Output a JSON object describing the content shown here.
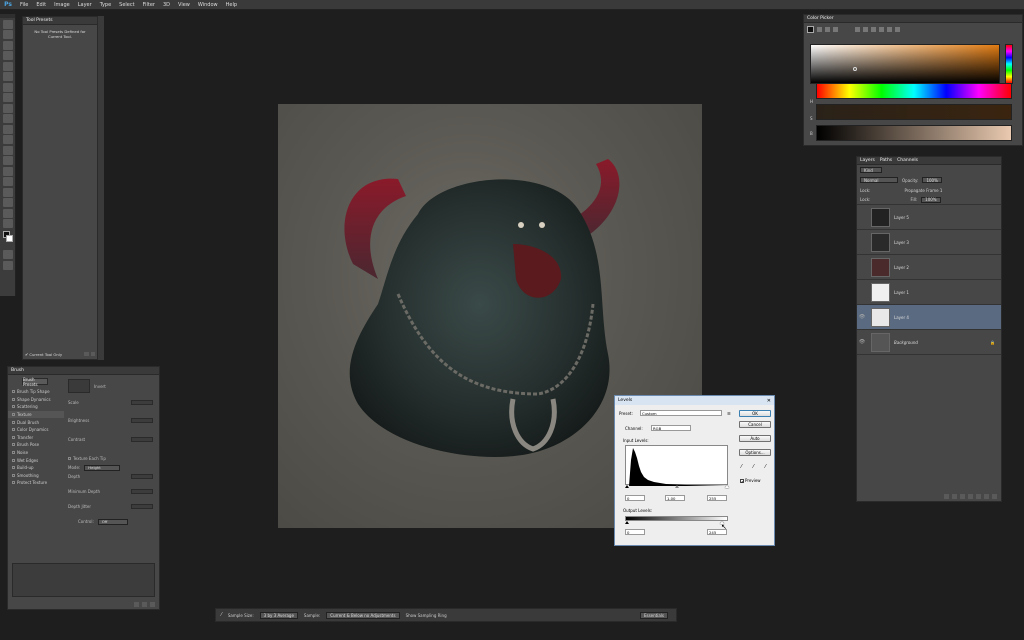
{
  "app": {
    "logo": "Ps"
  },
  "menu": [
    "File",
    "Edit",
    "Image",
    "Layer",
    "Type",
    "Select",
    "Filter",
    "3D",
    "View",
    "Window",
    "Help"
  ],
  "tool_presets": {
    "tab": "Tool Presets",
    "message": "No Tool Presets Defined for Current Tool.",
    "checkbox_label": "Current Tool Only"
  },
  "brush": {
    "tab": "Brush",
    "presets_button": "Brush Presets",
    "items": [
      "Brush Tip Shape",
      "Shape Dynamics",
      "Scattering",
      "Texture",
      "Dual Brush",
      "Color Dynamics",
      "Transfer",
      "Brush Pose",
      "Noise",
      "Wet Edges",
      "Build-up",
      "Smoothing",
      "Protect Texture"
    ],
    "fields": [
      "Invert",
      "Scale",
      "Brightness",
      "Contrast",
      "Texture Each Tip",
      "Mode:",
      "Depth",
      "Minimum Depth",
      "Depth Jitter",
      "Control:"
    ],
    "mode_value": "Height",
    "control_value": "Off"
  },
  "color_picker": {
    "tab": "Color Picker",
    "labels": [
      "H",
      "S",
      "B"
    ]
  },
  "layers": {
    "tabs": [
      "Layers",
      "Paths",
      "Channels"
    ],
    "kind": "Kind",
    "blend_mode": "Normal",
    "opacity_label": "Opacity:",
    "opacity_value": "100%",
    "lock_label": "Lock:",
    "fill_label": "Fill:",
    "fill_value": "100%",
    "propagate": "Propagate Frame 1",
    "rows": [
      {
        "name": "Layer 5"
      },
      {
        "name": "Layer 3"
      },
      {
        "name": "Layer 2"
      },
      {
        "name": "Layer 1"
      },
      {
        "name": "Layer 4",
        "selected": true
      },
      {
        "name": "Background",
        "italic": true
      }
    ]
  },
  "levels": {
    "title": "Levels",
    "preset_label": "Preset:",
    "preset_value": "Custom",
    "channel_label": "Channel:",
    "channel_value": "RGB",
    "input_label": "Input Levels:",
    "input_values": [
      "0",
      "1.00",
      "255"
    ],
    "output_label": "Output Levels:",
    "output_values": [
      "0",
      "245"
    ],
    "buttons": {
      "ok": "OK",
      "cancel": "Cancel",
      "auto": "Auto",
      "options": "Options..."
    },
    "preview_label": "Preview"
  },
  "options_bar": {
    "sample_size_label": "Sample Size:",
    "sample_size_value": "3 by 3 Average",
    "sample_label": "Sample:",
    "sample_value": "Current & Below no Adjustments",
    "show_ring": "Show Sampling Ring",
    "workspace": "Essentials"
  }
}
